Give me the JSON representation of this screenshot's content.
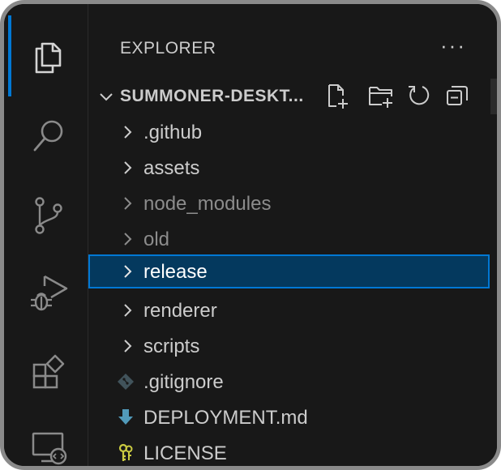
{
  "activity_bar": {
    "items": [
      {
        "name": "explorer",
        "icon": "files-icon",
        "active": true
      },
      {
        "name": "search",
        "icon": "search-icon",
        "active": false
      },
      {
        "name": "source-control",
        "icon": "source-control-icon",
        "active": false
      },
      {
        "name": "run-and-debug",
        "icon": "run-debug-icon",
        "active": false
      },
      {
        "name": "extensions",
        "icon": "extensions-icon",
        "active": false
      },
      {
        "name": "remote-explorer",
        "icon": "remote-explorer-icon",
        "active": false
      }
    ],
    "accent_color": "#0078d4"
  },
  "sidebar": {
    "title": "EXPLORER",
    "more_actions": "···",
    "section": {
      "title": "SUMMONER-DESKT...",
      "actions": [
        "new-file-icon",
        "new-folder-icon",
        "refresh-icon",
        "collapse-all-icon"
      ]
    },
    "tree": [
      {
        "label": ".github",
        "type": "folder"
      },
      {
        "label": "assets",
        "type": "folder"
      },
      {
        "label": "node_modules",
        "type": "folder",
        "dimmed": true
      },
      {
        "label": "old",
        "type": "folder",
        "dimmed": true
      },
      {
        "label": "release",
        "type": "folder",
        "selected": true
      },
      {
        "label": "renderer",
        "type": "folder"
      },
      {
        "label": "scripts",
        "type": "folder"
      },
      {
        "label": ".gitignore",
        "type": "file",
        "icon": "git-icon"
      },
      {
        "label": "DEPLOYMENT.md",
        "type": "file",
        "icon": "markdown-download-icon"
      },
      {
        "label": "LICENSE",
        "type": "file",
        "icon": "license-key-icon"
      }
    ]
  },
  "colors": {
    "background": "#181818",
    "text": "#cccccc",
    "text_dimmed": "#8c8c8c",
    "selection_bg": "#04395e",
    "selection_border": "#0078d4"
  }
}
